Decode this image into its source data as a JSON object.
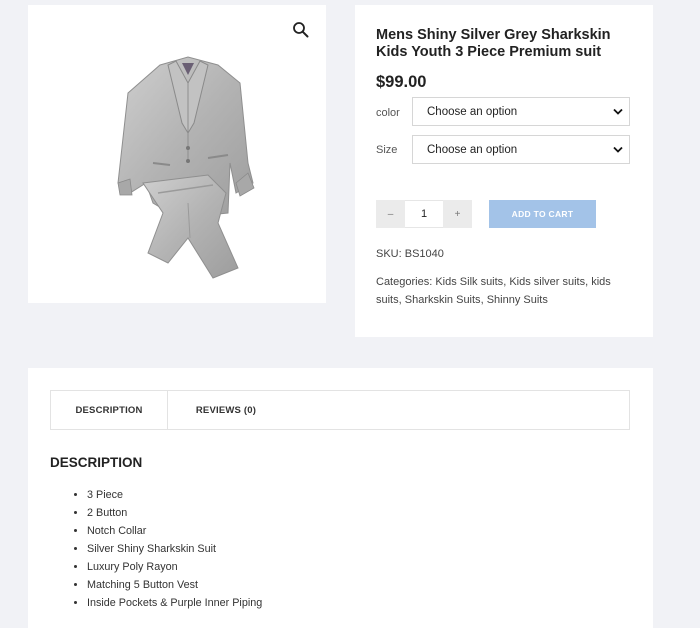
{
  "product": {
    "title": "Mens Shiny Silver Grey Sharkskin Kids Youth 3 Piece Premium suit",
    "price": "$99.00",
    "image_icon": "zoom-icon",
    "options": [
      {
        "label": "color",
        "selected": "Choose an option"
      },
      {
        "label": "Size",
        "selected": "Choose an option"
      }
    ],
    "quantity": {
      "minus": "–",
      "value": "1",
      "plus": "+"
    },
    "add_to_cart": "ADD TO CART",
    "sku_label": "SKU:",
    "sku": "BS1040",
    "categories_label": "Categories:",
    "categories": [
      "Kids Silk suits",
      "Kids silver suits",
      "kids suits",
      "Sharkskin Suits",
      "Shinny Suits"
    ]
  },
  "tabs": [
    {
      "label": "DESCRIPTION"
    },
    {
      "label": "REVIEWS (0)"
    }
  ],
  "description": {
    "heading": "DESCRIPTION",
    "items": [
      "3 Piece",
      "2 Button",
      "Notch Collar",
      "Silver Shiny Sharkskin Suit",
      "Luxury Poly Rayon",
      "Matching 5 Button Vest",
      "Inside Pockets & Purple Inner Piping"
    ]
  },
  "colors": {
    "background": "#f1f2f6",
    "card": "#ffffff",
    "button": "#a3c3e8",
    "suit": "#b9b9b9"
  }
}
